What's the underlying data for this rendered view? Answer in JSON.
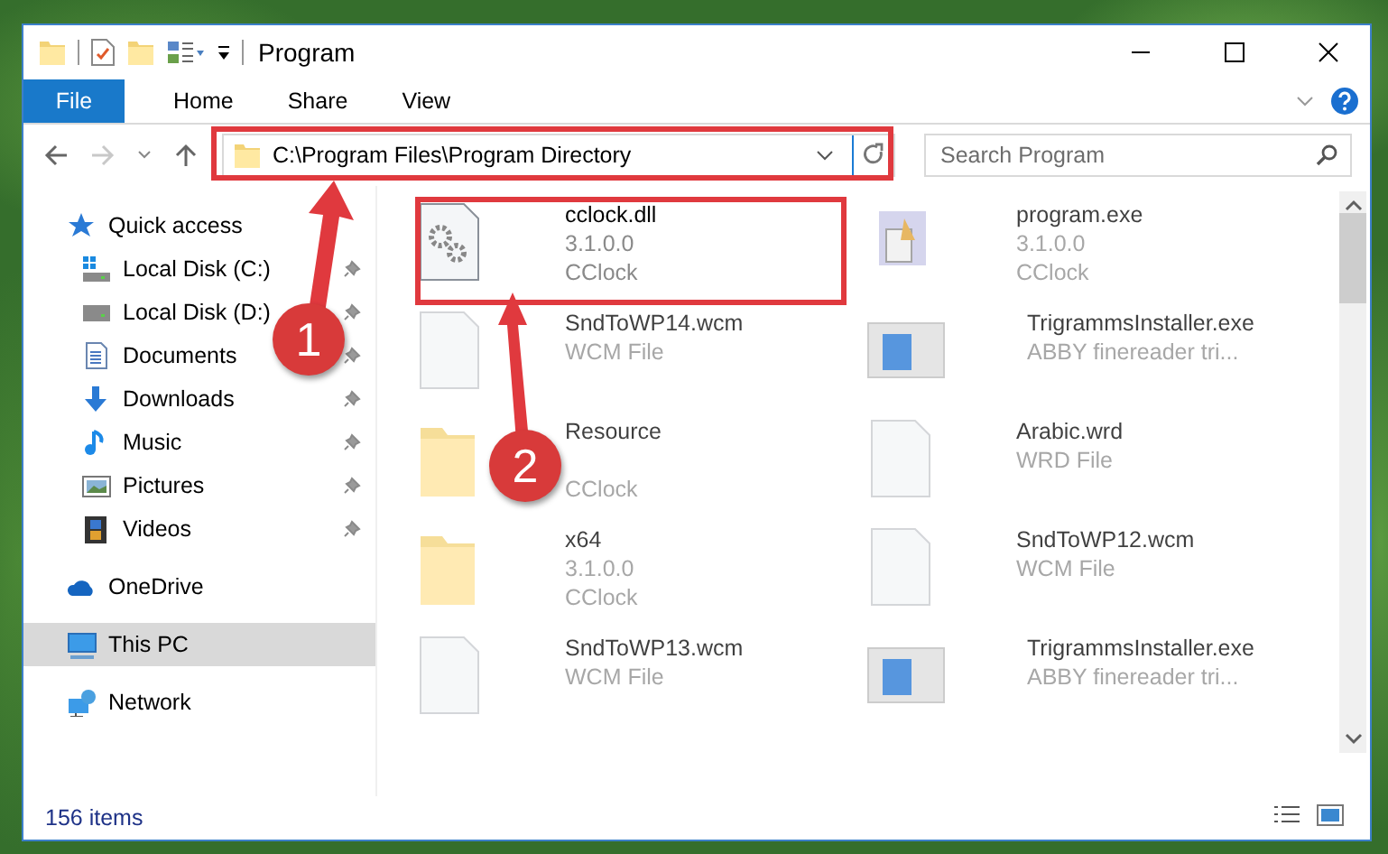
{
  "window": {
    "title": "Program"
  },
  "ribbon": {
    "tabs": [
      {
        "label": "File",
        "selected": true
      },
      {
        "label": "Home",
        "selected": false
      },
      {
        "label": "Share",
        "selected": false
      },
      {
        "label": "View",
        "selected": false
      }
    ]
  },
  "address_bar": {
    "path": "C:\\Program Files\\Program Directory"
  },
  "search": {
    "placeholder": "Search Program"
  },
  "sidebar": {
    "items": [
      {
        "label": "Quick access",
        "selected": false,
        "children": [
          {
            "label": "Local Disk (C:)",
            "pinned": true,
            "selected": false
          },
          {
            "label": "Local Disk (D:)",
            "pinned": true,
            "selected": false
          },
          {
            "label": "Documents",
            "pinned": true,
            "selected": false
          },
          {
            "label": "Downloads",
            "pinned": true,
            "selected": false
          },
          {
            "label": "Music",
            "pinned": true,
            "selected": false
          },
          {
            "label": "Pictures",
            "pinned": true,
            "selected": false
          },
          {
            "label": "Videos",
            "pinned": true,
            "selected": false
          }
        ]
      },
      {
        "label": "OneDrive",
        "selected": false
      },
      {
        "label": "This PC",
        "selected": true
      },
      {
        "label": "Network",
        "selected": false
      }
    ]
  },
  "files": [
    {
      "kind": "dll",
      "name": "cclock.dll",
      "details": [
        "3.1.0.0",
        "CClock"
      ]
    },
    {
      "kind": "app",
      "name": "program.exe",
      "details": [
        "3.1.0.0",
        "CClock"
      ]
    },
    {
      "kind": "document",
      "name": "SndToWP14.wcm",
      "details": [
        "WCM File"
      ]
    },
    {
      "kind": "installer",
      "name": "TrigrammsInstaller.exe",
      "details": [
        "ABBY finereader tri..."
      ]
    },
    {
      "kind": "folder",
      "name": "Resource",
      "details": [
        "CClock"
      ]
    },
    {
      "kind": "document",
      "name": "Arabic.wrd",
      "details": [
        "WRD File"
      ]
    },
    {
      "kind": "folder",
      "name": "x64",
      "details": [
        "3.1.0.0",
        "CClock"
      ]
    },
    {
      "kind": "document",
      "name": "SndToWP12.wcm",
      "details": [
        "WCM File"
      ]
    },
    {
      "kind": "document",
      "name": "SndToWP13.wcm",
      "details": [
        "WCM File"
      ]
    },
    {
      "kind": "installer",
      "name": "TrigrammsInstaller.exe",
      "details": [
        "ABBY finereader tri..."
      ]
    }
  ],
  "status_bar": {
    "item_count": "156 items"
  },
  "annotations": [
    {
      "number": "1"
    },
    {
      "number": "2"
    }
  ]
}
